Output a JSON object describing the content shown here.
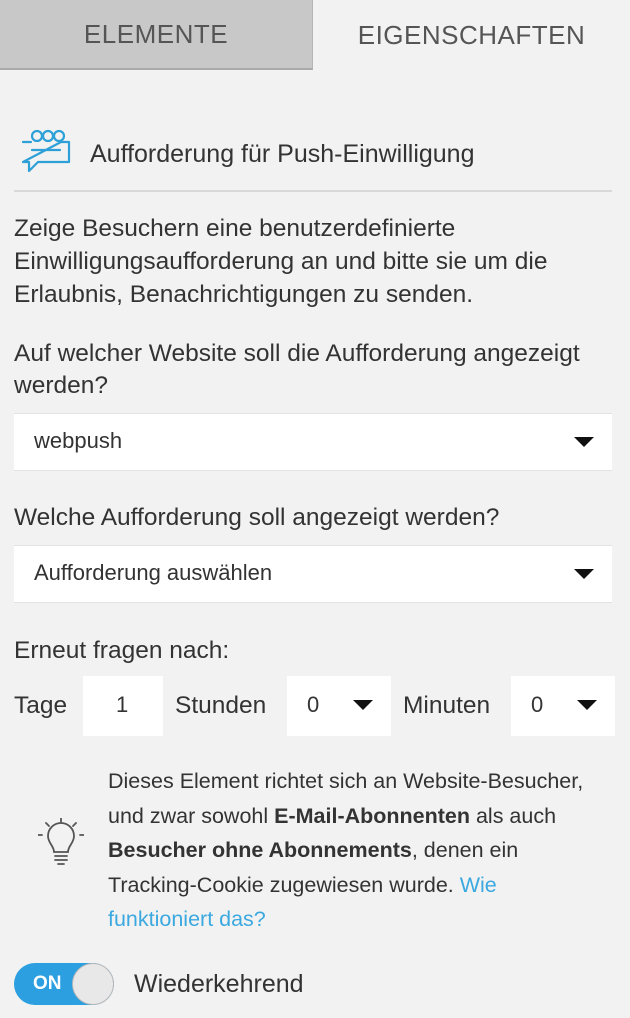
{
  "tabs": [
    {
      "label": "ELEMENTE",
      "active": false
    },
    {
      "label": "EIGENSCHAFTEN",
      "active": true
    }
  ],
  "header": {
    "title": "Aufforderung für Push-Einwilligung",
    "icon": "chat-bubbles-icon"
  },
  "description": "Zeige Besuchern eine benutzerdefinierte Einwilligungsaufforderung an und bitte sie um die Erlaubnis, Benachrichtigungen zu senden.",
  "website_question": "Auf welcher Website soll die Aufforderung angezeigt werden?",
  "website_select": {
    "value": "webpush"
  },
  "prompt_question": "Welche Aufforderung soll angezeigt werden?",
  "prompt_select": {
    "value": "Aufforderung auswählen"
  },
  "ask_again": {
    "label": "Erneut fragen nach:",
    "days_label": "Tage",
    "days_value": "1",
    "hours_label": "Stunden",
    "hours_value": "0",
    "minutes_label": "Minuten",
    "minutes_value": "0"
  },
  "info": {
    "icon": "lightbulb-icon",
    "text_1": "Dieses Element richtet sich an Website-Besucher, und zwar sowohl ",
    "bold_1": "E-Mail-Abonnenten",
    "text_2": " als auch ",
    "bold_2": "Besucher ohne Abonnements",
    "text_3": ", denen ein Tracking-Cookie zugewiesen wurde. ",
    "link": "Wie funktioniert das?"
  },
  "recurring": {
    "toggle_label": "ON",
    "label": "Wiederkehrend",
    "enabled": true
  },
  "colors": {
    "accent": "#2b9fe0",
    "link": "#3ba9e0",
    "icon": "#2ea0d8"
  }
}
